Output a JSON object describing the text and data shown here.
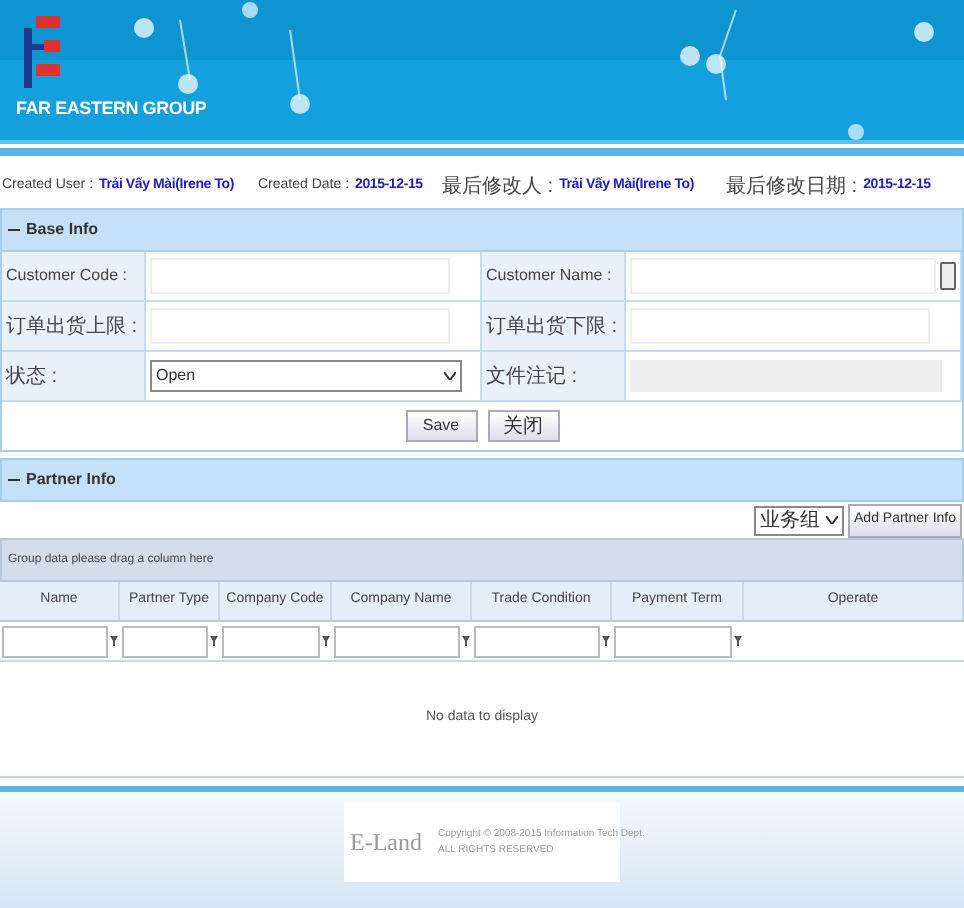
{
  "header": {
    "logo_text": "FAR EASTERN GROUP"
  },
  "meta": [
    {
      "label": "Created User :",
      "value": "Trải Vấy Mài(Irene To)"
    },
    {
      "label": "Created Date :",
      "value": "2015-12-15"
    },
    {
      "label": "最后修改人 :",
      "value": "Trải Vấy Mài(Irene To)"
    },
    {
      "label": "最后修改日期 :",
      "value": "2015-12-15"
    }
  ],
  "base_info": {
    "title": "Base Info",
    "expanded": true,
    "fields": [
      {
        "label": "Customer Code :",
        "kind": "text"
      },
      {
        "label": "Customer Name :",
        "kind": "lookup"
      },
      {
        "label": "订单出货上限 :",
        "kind": "text"
      },
      {
        "label": "订单出货下限 :",
        "kind": "text"
      },
      {
        "label": "状态 :",
        "kind": "select",
        "value": "Open"
      },
      {
        "label": "文件注记 :",
        "kind": "readonly"
      }
    ],
    "buttons": [
      "Save",
      "关闭"
    ]
  },
  "partner_info": {
    "title": "Partner Info",
    "expanded": true,
    "group_select": "业务组",
    "add_button": "Add Partner Info",
    "group_hint": "Group data please drag a column here",
    "columns": [
      {
        "label": "Name",
        "filter": true
      },
      {
        "label": "Partner Type",
        "filter": true
      },
      {
        "label": "Company Code",
        "filter": true
      },
      {
        "label": "Company Name",
        "filter": true
      },
      {
        "label": "Trade Condition",
        "filter": true
      },
      {
        "label": "Payment Term",
        "filter": true
      },
      {
        "label": "Operate",
        "filter": false
      }
    ],
    "empty_text": "No data to display"
  },
  "footer": {
    "brand": "E-Land",
    "copyright": "Copyright © 2008-2015 Information Tech Dept.",
    "rights": "ALL RIGHTS RESERVED"
  }
}
